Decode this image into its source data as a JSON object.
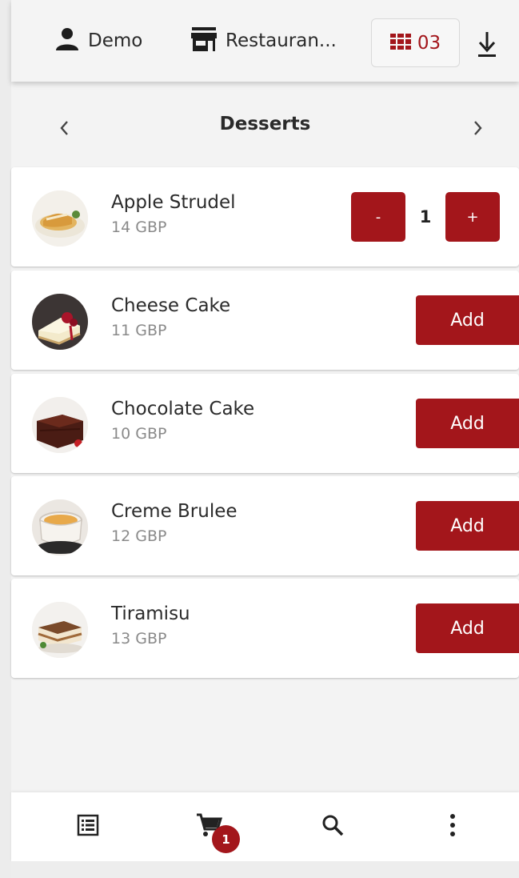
{
  "topbar": {
    "user_label": "Demo",
    "user_icon": "person-icon",
    "restaurant_label": "Restauran...",
    "restaurant_icon": "store-icon",
    "table_number": "03",
    "table_icon": "grid-icon",
    "download_icon": "download-icon"
  },
  "category": {
    "title": "Desserts",
    "prev_icon": "chevron-left-icon",
    "next_icon": "chevron-right-icon"
  },
  "items": [
    {
      "name": "Apple Strudel",
      "price": "14 GBP",
      "quantity": "1",
      "minus_label": "-",
      "plus_label": "+"
    },
    {
      "name": "Cheese Cake",
      "price": "11 GBP",
      "add_label": "Add"
    },
    {
      "name": "Chocolate Cake",
      "price": "10 GBP",
      "add_label": "Add"
    },
    {
      "name": "Creme Brulee",
      "price": "12 GBP",
      "add_label": "Add"
    },
    {
      "name": "Tiramisu",
      "price": "13 GBP",
      "add_label": "Add"
    }
  ],
  "bottom_nav": {
    "list_icon": "menu-list-icon",
    "cart_icon": "cart-icon",
    "cart_badge": "1",
    "search_icon": "search-icon",
    "more_icon": "more-vertical-icon"
  },
  "colors": {
    "accent": "#a3161b",
    "background": "#f3f3f3",
    "card": "#ffffff"
  }
}
